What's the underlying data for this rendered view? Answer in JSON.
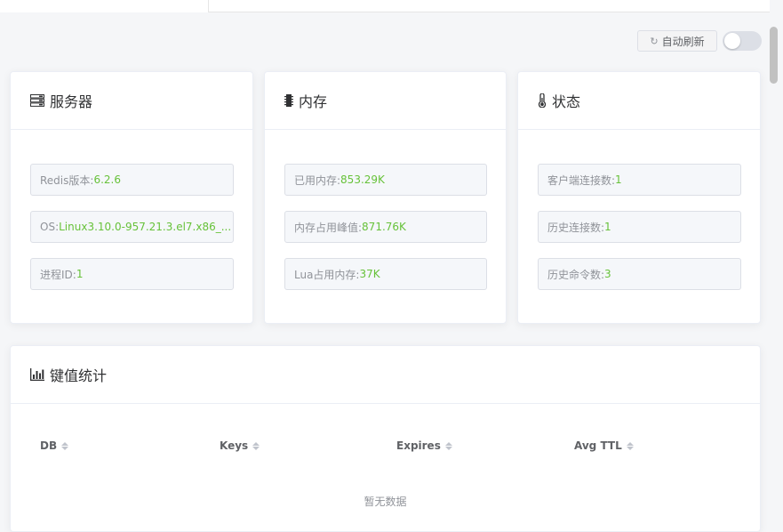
{
  "toolbar": {
    "refresh_label": "自动刷新",
    "auto_refresh_on": false
  },
  "cards": {
    "server": {
      "title": "服务器",
      "rows": [
        {
          "label": "Redis版本: ",
          "value": "6.2.6"
        },
        {
          "label": "OS: ",
          "value": "Linux3.10.0-957.21.3.el7.x86_..."
        },
        {
          "label": "进程ID: ",
          "value": "1"
        }
      ]
    },
    "memory": {
      "title": "内存",
      "rows": [
        {
          "label": "已用内存: ",
          "value": "853.29K"
        },
        {
          "label": "内存占用峰值: ",
          "value": "871.76K"
        },
        {
          "label": "Lua占用内存: ",
          "value": "37K"
        }
      ]
    },
    "status": {
      "title": "状态",
      "rows": [
        {
          "label": "客户端连接数: ",
          "value": "1"
        },
        {
          "label": "历史连接数: ",
          "value": "1"
        },
        {
          "label": "历史命令数: ",
          "value": "3"
        }
      ]
    }
  },
  "keys_table": {
    "title": "键值统计",
    "columns": [
      "DB",
      "Keys",
      "Expires",
      "Avg TTL"
    ],
    "empty_text": "暂无数据"
  },
  "colors": {
    "value_green": "#67c23a",
    "label_gray": "#909399"
  }
}
